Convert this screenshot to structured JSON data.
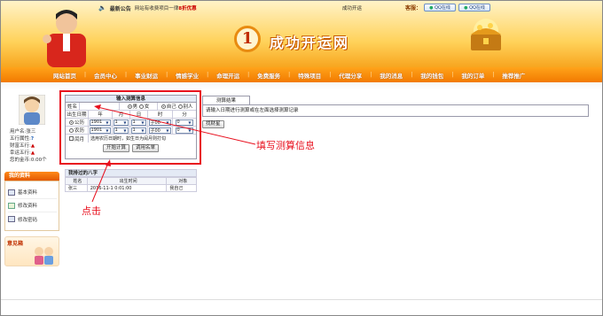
{
  "header": {
    "notice_label": "最新公告",
    "notice_text": "网站有收费项目一律",
    "notice_highlight": "8折优惠",
    "site_name": "成功开运",
    "service_label": "客服：",
    "qq_buttons": [
      "QQ在线",
      "QQ在线"
    ],
    "logo_number": "1",
    "logo_text": "成功开运网",
    "colors": {
      "nav_bg": "#f27a00",
      "accent": "#e8101e"
    }
  },
  "nav": {
    "items": [
      "网站首页",
      "会员中心",
      "事业财运",
      "情感学业",
      "命理开运",
      "免费服务",
      "特殊项目",
      "代理分享",
      "我的消息",
      "我的钱包",
      "我的订单",
      "推荐推广"
    ]
  },
  "sidebar": {
    "user_label": "用户名:",
    "username": "张三",
    "fields": [
      {
        "label": "五行属性:",
        "value": "?",
        "icon": "question-icon"
      },
      {
        "label": "财富五行:",
        "value": "▲",
        "icon": "triangle-icon"
      },
      {
        "label": "幸运五行:",
        "value": "▲",
        "icon": "triangle-icon"
      },
      {
        "label": "您的金币:",
        "value": "0.00个"
      }
    ],
    "panel_title": "我的资料",
    "links": [
      "基本资料",
      "修改资料",
      "修改密码"
    ],
    "mailbox_title": "意见箱"
  },
  "tabs": {
    "active": "测算结果"
  },
  "result": {
    "message": "请输入日期进行测算或在左面选择测算记录",
    "find_button": "找财星"
  },
  "form": {
    "title": "输入测算信息",
    "name_label": "姓名",
    "name_value": "",
    "gender_options": [
      "男",
      "女"
    ],
    "gender_selected": "男",
    "who_options": [
      "自己",
      "别人"
    ],
    "who_selected": "自己",
    "birth_label": "出生日期",
    "col_year": "年",
    "col_month": "月",
    "col_day": "日",
    "col_hour": "时",
    "col_minute": "分",
    "solar_label": "公历",
    "lunar_label": "农历",
    "solar_values": {
      "year": "1901",
      "month": "1",
      "day": "1",
      "hour": "子00",
      "minute": "0"
    },
    "lunar_values": {
      "year": "1901",
      "month": "1",
      "day": "1",
      "hour": "子00",
      "minute": "0"
    },
    "calendar_selected": "公历",
    "leap_label": "闰月",
    "leap_note": "选用农历日期时，如生日为闰月则打勾",
    "submit_button": "开始计算",
    "list_button": "调用名单"
  },
  "history": {
    "title": "我排过的八字",
    "columns": [
      "姓名",
      "出生时间",
      "对象"
    ],
    "rows": [
      [
        "张三",
        "2016-11-1 0:01:00",
        "我自己"
      ]
    ]
  },
  "annotations": {
    "fill_hint": "填写测算信息",
    "click_hint": "点击"
  }
}
